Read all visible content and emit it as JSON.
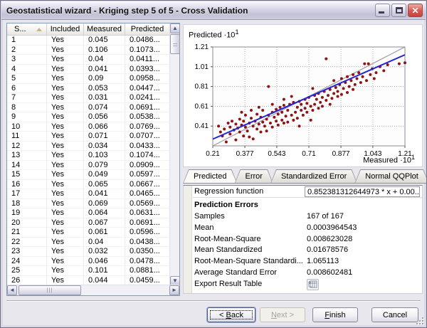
{
  "window": {
    "title": "Geostatistical wizard - Kriging step 5 of 5 - Cross Validation",
    "controls": [
      "minimize",
      "maximize",
      "close"
    ]
  },
  "table": {
    "columns": [
      "S...",
      "Included",
      "Measured",
      "Predicted"
    ],
    "sort_column": "S...",
    "sort_direction": "ascending",
    "rows": [
      [
        "1",
        "Yes",
        "0.045",
        "0.0486..."
      ],
      [
        "2",
        "Yes",
        "0.106",
        "0.1073..."
      ],
      [
        "3",
        "Yes",
        "0.04",
        "0.0411..."
      ],
      [
        "4",
        "Yes",
        "0.041",
        "0.0393..."
      ],
      [
        "5",
        "Yes",
        "0.09",
        "0.0958..."
      ],
      [
        "6",
        "Yes",
        "0.053",
        "0.0447..."
      ],
      [
        "7",
        "Yes",
        "0.031",
        "0.0241..."
      ],
      [
        "8",
        "Yes",
        "0.074",
        "0.0691..."
      ],
      [
        "9",
        "Yes",
        "0.056",
        "0.0538..."
      ],
      [
        "10",
        "Yes",
        "0.066",
        "0.0769..."
      ],
      [
        "11",
        "Yes",
        "0.071",
        "0.0707..."
      ],
      [
        "12",
        "Yes",
        "0.034",
        "0.0433..."
      ],
      [
        "13",
        "Yes",
        "0.103",
        "0.1074..."
      ],
      [
        "14",
        "Yes",
        "0.079",
        "0.0909..."
      ],
      [
        "15",
        "Yes",
        "0.049",
        "0.0597..."
      ],
      [
        "16",
        "Yes",
        "0.065",
        "0.0667..."
      ],
      [
        "17",
        "Yes",
        "0.041",
        "0.0465..."
      ],
      [
        "18",
        "Yes",
        "0.069",
        "0.0569..."
      ],
      [
        "19",
        "Yes",
        "0.064",
        "0.0631..."
      ],
      [
        "20",
        "Yes",
        "0.067",
        "0.0691..."
      ],
      [
        "21",
        "Yes",
        "0.061",
        "0.0596..."
      ],
      [
        "22",
        "Yes",
        "0.04",
        "0.0438..."
      ],
      [
        "23",
        "Yes",
        "0.032",
        "0.0350..."
      ],
      [
        "24",
        "Yes",
        "0.046",
        "0.0478..."
      ],
      [
        "25",
        "Yes",
        "0.101",
        "0.0881..."
      ],
      [
        "26",
        "Yes",
        "0.044",
        "0.0459..."
      ]
    ]
  },
  "chart_data": {
    "type": "scatter",
    "title": "",
    "ylabel_base": "Predicted ·10",
    "ylabel_sup": "1",
    "xlabel_base": "Measured ·10",
    "xlabel_sup": "1",
    "xlim": [
      0.21,
      1.21
    ],
    "ylim": [
      0.21,
      1.21
    ],
    "xticks": [
      0.21,
      0.377,
      0.543,
      0.71,
      0.877,
      1.043,
      1.21
    ],
    "yticks": [
      0.41,
      0.61,
      0.81,
      1.01,
      1.21
    ],
    "grid": true,
    "legend": "none",
    "point_color": "#8e1414",
    "reference_line": {
      "from": [
        0.21,
        0.21
      ],
      "to": [
        1.21,
        1.21
      ],
      "color": "#9c9ca4"
    },
    "regression_line": {
      "slope": 0.852381312644973,
      "intercept": 0.0995,
      "color": "#2424d2"
    },
    "points": [
      [
        0.24,
        0.41
      ],
      [
        0.25,
        0.35
      ],
      [
        0.26,
        0.31
      ],
      [
        0.27,
        0.38
      ],
      [
        0.28,
        0.25
      ],
      [
        0.29,
        0.44
      ],
      [
        0.3,
        0.4
      ],
      [
        0.3,
        0.33
      ],
      [
        0.31,
        0.46
      ],
      [
        0.32,
        0.37
      ],
      [
        0.33,
        0.27
      ],
      [
        0.33,
        0.43
      ],
      [
        0.34,
        0.39
      ],
      [
        0.35,
        0.48
      ],
      [
        0.35,
        0.35
      ],
      [
        0.36,
        0.42
      ],
      [
        0.36,
        0.55
      ],
      [
        0.37,
        0.31
      ],
      [
        0.37,
        0.46
      ],
      [
        0.38,
        0.4
      ],
      [
        0.38,
        0.52
      ],
      [
        0.39,
        0.36
      ],
      [
        0.4,
        0.44
      ],
      [
        0.4,
        0.3
      ],
      [
        0.41,
        0.49
      ],
      [
        0.41,
        0.57
      ],
      [
        0.42,
        0.41
      ],
      [
        0.42,
        0.28
      ],
      [
        0.43,
        0.46
      ],
      [
        0.44,
        0.38
      ],
      [
        0.44,
        0.53
      ],
      [
        0.45,
        0.43
      ],
      [
        0.45,
        0.6
      ],
      [
        0.46,
        0.35
      ],
      [
        0.46,
        0.5
      ],
      [
        0.47,
        0.45
      ],
      [
        0.47,
        0.57
      ],
      [
        0.48,
        0.41
      ],
      [
        0.49,
        0.48
      ],
      [
        0.49,
        0.36
      ],
      [
        0.5,
        0.52
      ],
      [
        0.5,
        0.81
      ],
      [
        0.51,
        0.44
      ],
      [
        0.52,
        0.55
      ],
      [
        0.52,
        0.4
      ],
      [
        0.52,
        0.63
      ],
      [
        0.53,
        0.5
      ],
      [
        0.54,
        0.46
      ],
      [
        0.54,
        0.58
      ],
      [
        0.55,
        0.42
      ],
      [
        0.55,
        0.53
      ],
      [
        0.56,
        0.6
      ],
      [
        0.57,
        0.47
      ],
      [
        0.57,
        0.55
      ],
      [
        0.58,
        0.44
      ],
      [
        0.58,
        0.62
      ],
      [
        0.58,
        0.68
      ],
      [
        0.59,
        0.51
      ],
      [
        0.6,
        0.57
      ],
      [
        0.6,
        0.45
      ],
      [
        0.61,
        0.63
      ],
      [
        0.62,
        0.52
      ],
      [
        0.62,
        0.71
      ],
      [
        0.63,
        0.47
      ],
      [
        0.63,
        0.65
      ],
      [
        0.64,
        0.55
      ],
      [
        0.65,
        0.6
      ],
      [
        0.65,
        0.49
      ],
      [
        0.66,
        0.66
      ],
      [
        0.66,
        0.41
      ],
      [
        0.67,
        0.57
      ],
      [
        0.67,
        0.63
      ],
      [
        0.68,
        0.52
      ],
      [
        0.69,
        0.68
      ],
      [
        0.69,
        0.59
      ],
      [
        0.7,
        0.64
      ],
      [
        0.7,
        0.55
      ],
      [
        0.71,
        0.7
      ],
      [
        0.72,
        0.61
      ],
      [
        0.72,
        0.47
      ],
      [
        0.73,
        0.57
      ],
      [
        0.73,
        0.79
      ],
      [
        0.74,
        0.72
      ],
      [
        0.74,
        0.63
      ],
      [
        0.75,
        0.68
      ],
      [
        0.76,
        0.59
      ],
      [
        0.76,
        0.74
      ],
      [
        0.77,
        0.65
      ],
      [
        0.78,
        0.7
      ],
      [
        0.78,
        0.61
      ],
      [
        0.79,
        0.76
      ],
      [
        0.8,
        1.09
      ],
      [
        0.8,
        0.67
      ],
      [
        0.81,
        0.72
      ],
      [
        0.82,
        0.63
      ],
      [
        0.82,
        0.78
      ],
      [
        0.83,
        0.69
      ],
      [
        0.84,
        0.74
      ],
      [
        0.84,
        0.87
      ],
      [
        0.85,
        0.8
      ],
      [
        0.86,
        0.71
      ],
      [
        0.86,
        0.76
      ],
      [
        0.87,
        0.83
      ],
      [
        0.88,
        0.73
      ],
      [
        0.88,
        0.89
      ],
      [
        0.89,
        0.79
      ],
      [
        0.9,
        0.85
      ],
      [
        0.91,
        0.75
      ],
      [
        0.91,
        0.91
      ],
      [
        0.92,
        0.81
      ],
      [
        0.93,
        0.87
      ],
      [
        0.94,
        0.78
      ],
      [
        0.94,
        0.93
      ],
      [
        0.95,
        0.83
      ],
      [
        0.96,
        0.89
      ],
      [
        0.97,
        0.95
      ],
      [
        0.98,
        0.85
      ],
      [
        0.99,
        0.91
      ],
      [
        1.0,
        1.04
      ],
      [
        1.01,
        0.87
      ],
      [
        1.02,
        1.04
      ],
      [
        1.03,
        0.93
      ],
      [
        1.04,
        0.99
      ],
      [
        1.05,
        0.89
      ],
      [
        1.06,
        0.95
      ],
      [
        1.08,
        1.01
      ],
      [
        1.1,
        0.97
      ],
      [
        1.12,
        1.03
      ],
      [
        1.18,
        1.04
      ],
      [
        1.21,
        1.05
      ]
    ]
  },
  "tabs": [
    {
      "label": "Predicted",
      "selected": true
    },
    {
      "label": "Error",
      "selected": false
    },
    {
      "label": "Standardized Error",
      "selected": false
    },
    {
      "label": "Normal QQPlot",
      "selected": false
    }
  ],
  "regression": {
    "label": "Regression function",
    "value": "0.852381312644973 * x + 0.00..."
  },
  "prediction_errors": {
    "header": "Prediction Errors",
    "rows": [
      {
        "label": "Samples",
        "value": "167 of 167"
      },
      {
        "label": "Mean",
        "value": "0.0003964543"
      },
      {
        "label": "Root-Mean-Square",
        "value": "0.008623028"
      },
      {
        "label": "Mean Standardized",
        "value": "0.01678576"
      },
      {
        "label": "Root-Mean-Square Standardi...",
        "value": "1.065113"
      },
      {
        "label": "Average Standard Error",
        "value": "0.008602481"
      }
    ],
    "export_label": "Export Result Table"
  },
  "buttons": {
    "back": {
      "pre": "< ",
      "key": "B",
      "post": "ack"
    },
    "next": {
      "pre": "",
      "key": "N",
      "post": "ext >",
      "disabled": true
    },
    "finish": {
      "pre": "",
      "key": "F",
      "post": "inish"
    },
    "cancel": {
      "label": "Cancel"
    }
  },
  "colors": {
    "dialog_face": "#e8e7ed",
    "point": "#8e1414",
    "regression": "#2424d2",
    "reference": "#9c9ca4",
    "grid_border": "#7f9db9"
  }
}
